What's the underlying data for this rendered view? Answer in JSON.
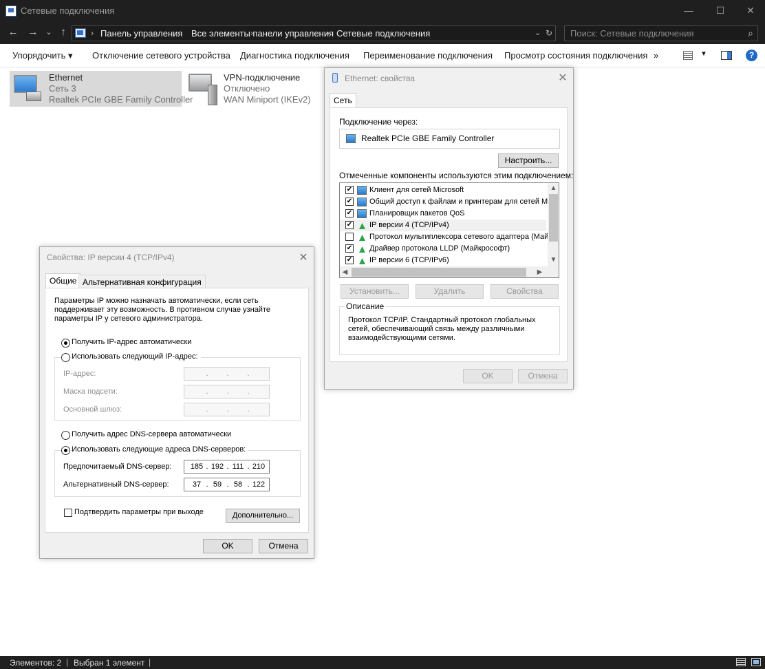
{
  "window": {
    "title": "Сетевые подключения",
    "minimize": "—",
    "maximize": "☐",
    "close": "✕"
  },
  "nav": {
    "back": "←",
    "forward": "→",
    "recent": "⌄",
    "up": "↑",
    "breadcrumbs": [
      "Панель управления",
      "Все элементы панели управления",
      "Сетевые подключения"
    ],
    "search_placeholder": "Поиск: Сетевые подключения"
  },
  "commands": {
    "organize": "Упорядочить ▾",
    "disable": "Отключение сетевого устройства",
    "diagnose": "Диагностика подключения",
    "rename": "Переименование подключения",
    "status": "Просмотр состояния подключения",
    "more": "»"
  },
  "connections": [
    {
      "name": "Ethernet",
      "network": "Сеть 3",
      "adapter": "Realtek PCIe GBE Family Controller"
    },
    {
      "name": "VPN-подключение",
      "network": "Отключено",
      "adapter": "WAN Miniport (IKEv2)"
    }
  ],
  "eth_dialog": {
    "title": "Ethernet: свойства",
    "tab": "Сеть",
    "connect_via": "Подключение через:",
    "adapter": "Realtek PCIe GBE Family Controller",
    "configure": "Настроить...",
    "components_label": "Отмеченные компоненты используются этим подключением:",
    "components": [
      {
        "label": "Клиент для сетей Microsoft",
        "checked": true,
        "icon": "network-client-icon"
      },
      {
        "label": "Общий доступ к файлам и принтерам для сетей Mi",
        "checked": true,
        "icon": "network-service-icon"
      },
      {
        "label": "Планировщик пакетов QoS",
        "checked": true,
        "icon": "network-service-icon"
      },
      {
        "label": "IP версии 4 (TCP/IPv4)",
        "checked": true,
        "icon": "protocol-icon"
      },
      {
        "label": "Протокол мультиплексора сетевого адаптера (Май",
        "checked": false,
        "icon": "protocol-icon"
      },
      {
        "label": "Драйвер протокола LLDP (Майкрософт)",
        "checked": true,
        "icon": "protocol-icon"
      },
      {
        "label": "IP версии 6 (TCP/IPv6)",
        "checked": true,
        "icon": "protocol-icon"
      }
    ],
    "install": "Установить...",
    "remove": "Удалить",
    "properties": "Свойства",
    "desc_label": "Описание",
    "desc_text": "Протокол TCP/IP. Стандартный протокол глобальных сетей, обеспечивающий связь между различными взаимодействующими сетями.",
    "ok": "OK",
    "cancel": "Отмена"
  },
  "ipv4_dialog": {
    "title": "Свойства: IP версии 4 (TCP/IPv4)",
    "tab_general": "Общие",
    "tab_alt": "Альтернативная конфигурация",
    "intro": "Параметры IP можно назначать автоматически, если сеть поддерживает эту возможность. В противном случае узнайте параметры IP у сетевого администратора.",
    "auto_ip": "Получить IP-адрес автоматически",
    "manual_ip": "Использовать следующий IP-адрес:",
    "ip_label": "IP-адрес:",
    "mask_label": "Маска подсети:",
    "gateway_label": "Основной шлюз:",
    "auto_dns": "Получить адрес DNS-сервера автоматически",
    "manual_dns": "Использовать следующие адреса DNS-серверов:",
    "pref_dns_label": "Предпочитаемый DNS-сервер:",
    "alt_dns_label": "Альтернативный DNS-сервер:",
    "pref_dns": [
      "185",
      "192",
      "111",
      "210"
    ],
    "alt_dns": [
      "37",
      "59",
      "58",
      "122"
    ],
    "confirm": "Подтвердить параметры при выходе",
    "advanced": "Дополнительно...",
    "ok": "OK",
    "cancel": "Отмена"
  },
  "statusbar": {
    "items": "Элементов: 2",
    "selected": "Выбран 1 элемент"
  }
}
